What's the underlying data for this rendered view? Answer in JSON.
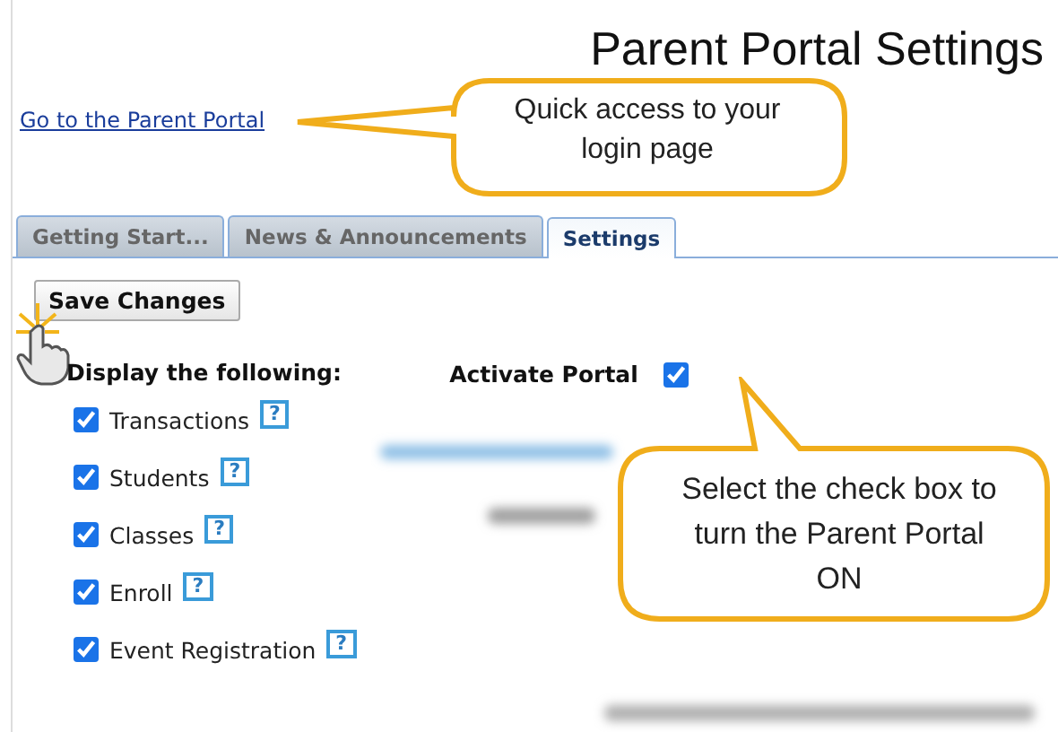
{
  "page_title": "Parent Portal Settings",
  "portal_link": "Go to the Parent Portal",
  "tabs": [
    {
      "label": "Getting Start...",
      "selected": false
    },
    {
      "label": "News & Announcements",
      "selected": false
    },
    {
      "label": "Settings",
      "selected": true
    }
  ],
  "save_button": "Save Changes",
  "display_heading": "Display the following:",
  "display_options": [
    {
      "label": "Transactions",
      "checked": true,
      "help": "?"
    },
    {
      "label": "Students",
      "checked": true,
      "help": "?"
    },
    {
      "label": "Classes",
      "checked": true,
      "help": "?"
    },
    {
      "label": "Enroll",
      "checked": true,
      "help": "?"
    },
    {
      "label": "Event Registration",
      "checked": true,
      "help": "?"
    }
  ],
  "activate_portal": {
    "label": "Activate Portal",
    "checked": true
  },
  "callouts": [
    {
      "text": "Quick access to your login page"
    },
    {
      "text": "Select the check box to turn the Parent Portal ON"
    }
  ]
}
